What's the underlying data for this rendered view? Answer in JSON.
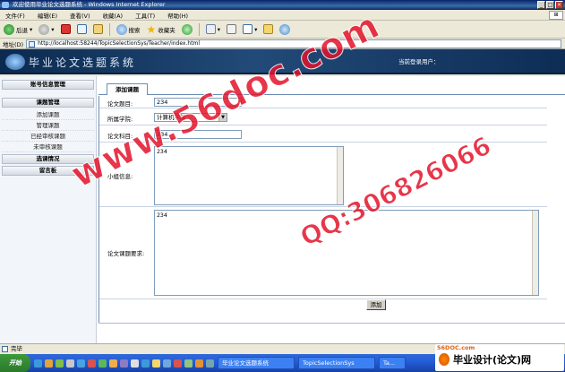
{
  "window": {
    "title": "欢迎使用毕业论文选题系统 - Windows Internet Explorer",
    "controls": [
      "_",
      "□",
      "×"
    ]
  },
  "menu": [
    "文件(F)",
    "编辑(E)",
    "查看(V)",
    "收藏(A)",
    "工具(T)",
    "帮助(H)"
  ],
  "toolbar": {
    "back": "后退",
    "search": "搜索",
    "favorites": "收藏夹"
  },
  "address": {
    "label": "地址(D)",
    "url": "http://localhost:58244/TopicSelectionSys/Teacher/index.html"
  },
  "banner": {
    "title": "毕业论文选题系统",
    "current_user_label": "当前登录用户："
  },
  "sidebar": {
    "section_account": "账号信息管理",
    "section_topic": "课题管理",
    "items": [
      "添加课题",
      "管理课题",
      "已经审核课题",
      "未审核课题"
    ],
    "section_selection": "选课情况",
    "section_board": "留言板"
  },
  "tab": {
    "label": "添加课题"
  },
  "form": {
    "title_label": "论文题目:",
    "title_value": "234",
    "college_label": "所属学院:",
    "college_value": "计算机学院",
    "subject_label": "论文科目:",
    "subject_value": "234",
    "info_label": "小组信息:",
    "info_value": "234",
    "requirement_label": "论文课题要求:",
    "requirement_value": "234",
    "submit_label": "添加"
  },
  "status": {
    "text": "完毕"
  },
  "taskbar": {
    "start": "开始",
    "tasks": [
      "毕业论文选题系统",
      "TopicSelectionSys",
      "Ta..."
    ]
  },
  "watermarks": {
    "site": "www.56doc.com",
    "qq": "QQ:306826066",
    "brand_url": "56DOC.com",
    "brand_name": "毕业设计(论文)网"
  },
  "colors": {
    "banner": "#0b2a4f",
    "watermark": "#e3132b",
    "taskbar": "#245edb"
  }
}
